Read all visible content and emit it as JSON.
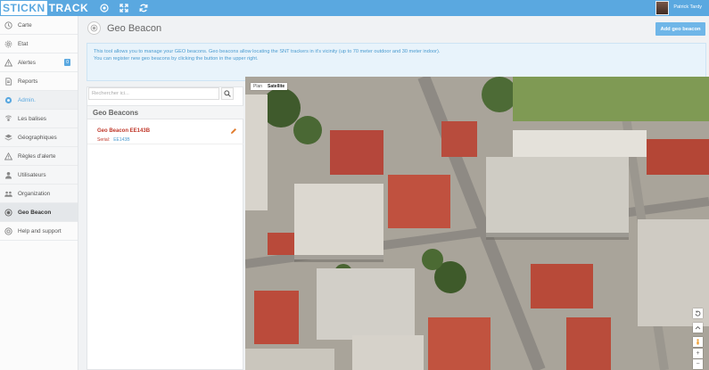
{
  "header": {
    "logo_part1": "STICKN",
    "logo_part2": "TRACK",
    "user_name": "Patrick Tardy",
    "icons": [
      "target-icon",
      "expand-icon",
      "refresh-icon"
    ]
  },
  "sidebar": {
    "items": [
      {
        "label": "Carte",
        "icon": "clock-icon"
      },
      {
        "label": "Etat",
        "icon": "gear-icon"
      },
      {
        "label": "Alertes",
        "icon": "warning-icon",
        "badge": "0"
      },
      {
        "label": "Reports",
        "icon": "document-icon"
      },
      {
        "label": "Admin.",
        "icon": "cogs-icon"
      },
      {
        "label": "Les balises",
        "icon": "signal-icon"
      },
      {
        "label": "Géographiques",
        "icon": "layers-icon"
      },
      {
        "label": "Règles d'alerte",
        "icon": "warning-icon"
      },
      {
        "label": "Utilisateurs",
        "icon": "user-icon"
      },
      {
        "label": "Organization",
        "icon": "group-icon"
      },
      {
        "label": "Geo Beacon",
        "icon": "beacon-icon"
      },
      {
        "label": "Help and support",
        "icon": "lifebuoy-icon"
      }
    ]
  },
  "page": {
    "title": "Geo Beacon",
    "add_button": "Add geo beacon",
    "info_line1": "This tool allows you to manage your GEO beacons. Geo beacons allow locating the SNT trackers in it's vicinity (up to 70 meter outdoor and 30 meter indoor).",
    "info_line2": "You can register new geo beacons by clicking the button in the upper right."
  },
  "list": {
    "search_placeholder": "Rechercher ici...",
    "title": "Geo Beacons",
    "beacons": [
      {
        "name": "Geo Beacon EE143B",
        "serial_label": "Serial:",
        "serial": "EE143B"
      }
    ]
  },
  "map": {
    "toggle_plan": "Plan",
    "toggle_satellite": "Satellite",
    "active_mode": "Satellite",
    "zoom_in": "+",
    "zoom_out": "−"
  },
  "colors": {
    "accent": "#5aa8e0",
    "info_bg": "#e8f3fb",
    "beacon_name": "#c0392b"
  }
}
